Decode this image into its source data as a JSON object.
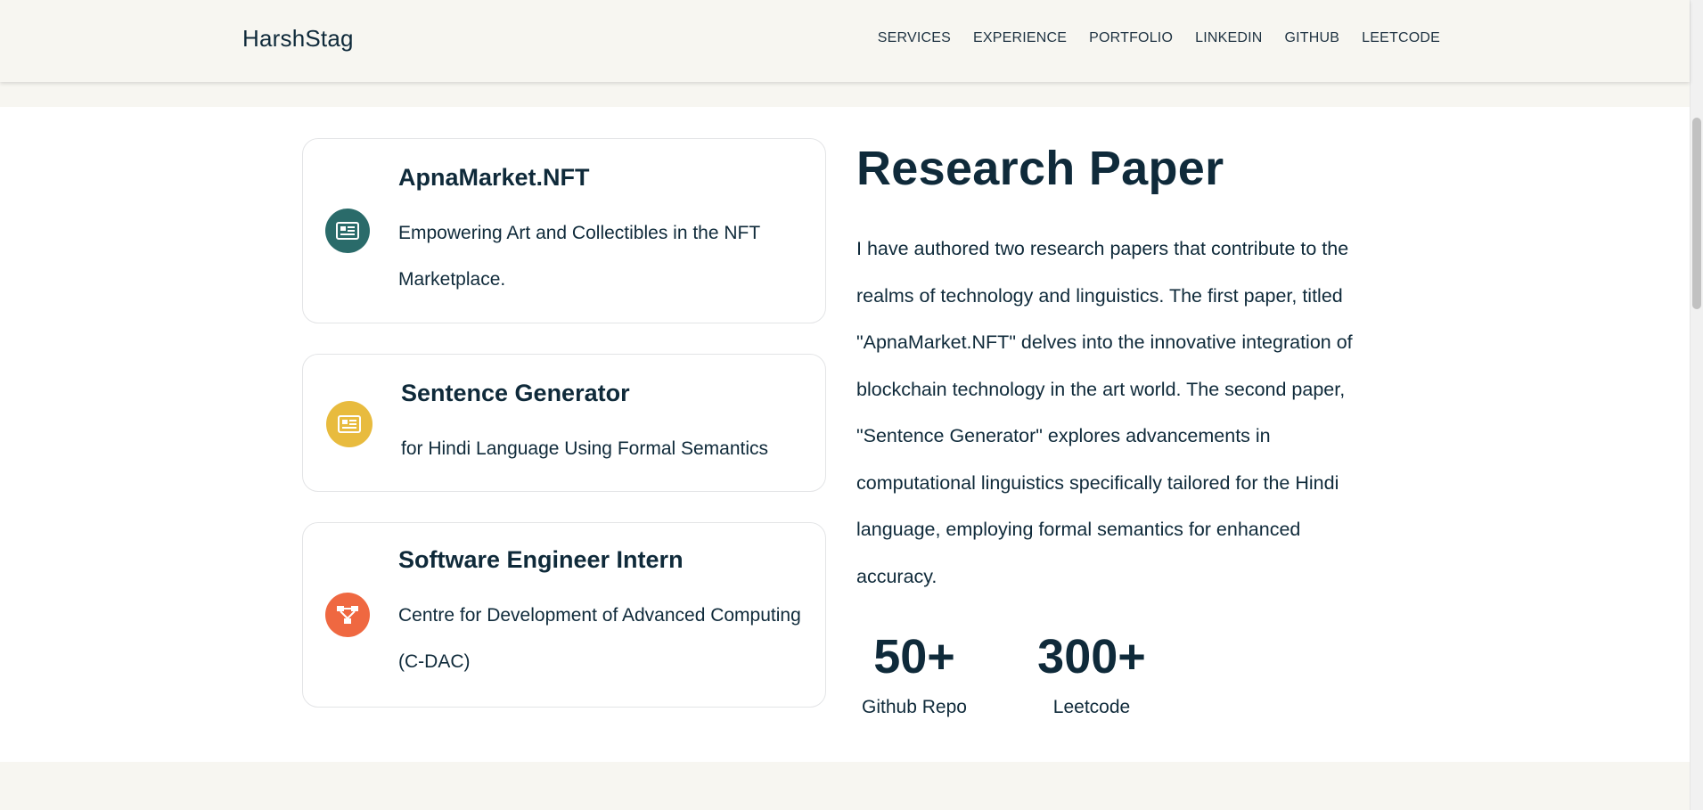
{
  "header": {
    "logo": "HarshStag",
    "nav": [
      {
        "label": "SERVICES"
      },
      {
        "label": "EXPERIENCE"
      },
      {
        "label": "PORTFOLIO"
      },
      {
        "label": "LINKEDIN"
      },
      {
        "label": "GITHUB"
      },
      {
        "label": "LEETCODE"
      }
    ]
  },
  "cards": [
    {
      "title": "ApnaMarket.NFT",
      "description": "Empowering Art and Collectibles in the NFT Marketplace.",
      "icon": "newspaper-icon",
      "color": "#2a6b6a"
    },
    {
      "title": "Sentence Generator",
      "description": "for Hindi Language Using Formal Semantics",
      "icon": "newspaper-icon",
      "color": "#e8bb3e"
    },
    {
      "title": "Software Engineer Intern",
      "description": "Centre for Development of Advanced Computing (C-DAC)",
      "icon": "network-icon",
      "color": "#ef6841"
    }
  ],
  "section": {
    "title": "Research Paper",
    "body": "I have authored two research papers that contribute to the realms of technology and linguistics. The first paper, titled \"ApnaMarket.NFT\" delves into the innovative integration of blockchain technology in the art world. The second paper, \"Sentence Generator\" explores advancements in computational linguistics specifically tailored for the Hindi language, employing formal semantics for enhanced accuracy."
  },
  "stats": [
    {
      "value": "50+",
      "label": "Github Repo"
    },
    {
      "value": "300+",
      "label": "Leetcode"
    }
  ]
}
